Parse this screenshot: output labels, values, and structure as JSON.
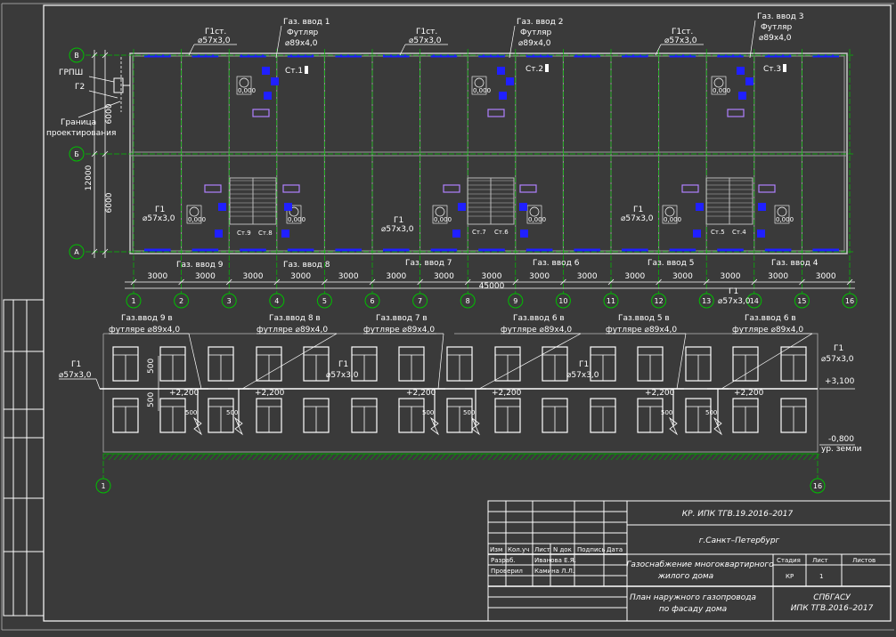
{
  "axes_rows": [
    "В",
    "Б",
    "А"
  ],
  "axes_cols": [
    "1",
    "2",
    "3",
    "4",
    "5",
    "6",
    "7",
    "8",
    "9",
    "10",
    "11",
    "12",
    "13",
    "14",
    "15",
    "16"
  ],
  "span_dims": [
    "3000",
    "3000",
    "3000",
    "3000",
    "3000",
    "3000",
    "3000",
    "3000",
    "3000",
    "3000",
    "3000",
    "3000",
    "3000",
    "3000",
    "3000"
  ],
  "total_dim": "45000",
  "vert_dims": [
    "6000",
    "6000",
    "12000"
  ],
  "left_labels": {
    "grpsh": "ГРПШ",
    "g2": "Г2",
    "border1": "Граница",
    "border2": "проектирования"
  },
  "plan": {
    "g1st": "Г1ст.",
    "pipe57": "⌀57х3,0",
    "g1": "Г1",
    "futlyar": "Футляр",
    "futlyar_dim": "⌀89х4,0",
    "inputs_top": [
      "Газ. ввод 1",
      "Газ. ввод 2",
      "Газ. ввод 3"
    ],
    "risers_top": [
      "Ст.1",
      "Ст.2",
      "Ст.3"
    ],
    "inputs_bottom": [
      "Газ. ввод 9",
      "Газ. ввод 8",
      "Газ. ввод 7",
      "Газ. ввод 6",
      "Газ. ввод 5",
      "Газ. ввод 4"
    ],
    "risers_bottom": [
      "Ст.9",
      "Ст.8",
      "Ст.7",
      "Ст.6",
      "Ст.5",
      "Ст.4"
    ],
    "stove_label": "0,000"
  },
  "facade": {
    "inputs": [
      {
        "title": "Газ.ввод 9 в",
        "sub": "футляре  ⌀89х4,0"
      },
      {
        "title": "Газ.ввод 8 в",
        "sub": "футляре  ⌀89х4,0"
      },
      {
        "title": "Газ.ввод 7 в",
        "sub": "футляре  ⌀89х4,0"
      },
      {
        "title": "Газ.ввод 6 в",
        "sub": "футляре  ⌀89х4,0"
      },
      {
        "title": "Газ.ввод 5 в",
        "sub": "футляре  ⌀89х4,0"
      },
      {
        "title": "Газ.ввод 6 в",
        "sub": "футляре  ⌀89х4,0"
      }
    ],
    "g1": "Г1",
    "pipe57": "⌀57х3,0",
    "elev_inputs": "+2,200",
    "elev_top": "+3,100",
    "elev_ground": "-0,800",
    "ground": "ур. земли",
    "dim500": "500",
    "valve": "500",
    "axis_left": "1",
    "axis_right": "16"
  },
  "stamp": {
    "code": "КР. ИПК ТГВ.19.2016–2017",
    "city": "г.Санкт–Петербург",
    "col_heads": [
      "Изм",
      "Кол.уч",
      "Лист",
      "N док",
      "Подпись",
      "Дата"
    ],
    "row1_role": "Разраб.",
    "row1_name": "Иванова Е.Я.",
    "row2_role": "Проверил",
    "row2_name": "Камина Л.Л.",
    "title1": "Газоснабжение многоквартирного",
    "title2": "жилого дома",
    "stage_h": "Стадия",
    "sheet_h": "Лист",
    "sheets_h": "Листов",
    "stage_v": "КР",
    "sheet_v": "1",
    "drawing1": "План наружного газопровода",
    "drawing2": "по фасаду дома",
    "org1": "СПбГАСУ",
    "org2": "ИПК ТГВ.2016–2017"
  },
  "colors": {
    "background": "#3a3a3a",
    "lines": "#ffffff",
    "axes": "#00c000",
    "walls": "#c0c0c0",
    "windows": "#2020ff",
    "hatch": "#00a000",
    "fixtures": "#b080ff"
  }
}
